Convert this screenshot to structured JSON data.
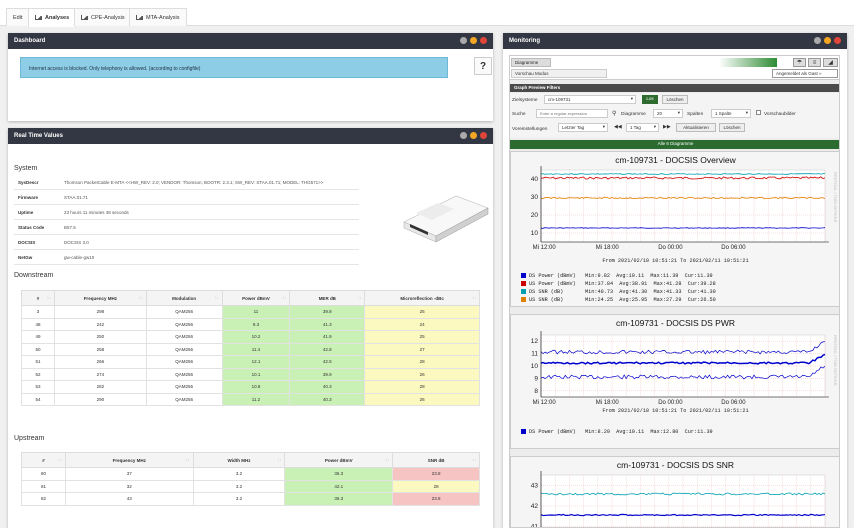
{
  "tabs": [
    {
      "label": "Edit"
    },
    {
      "label": "Analyses"
    },
    {
      "label": "CPE-Analysis"
    },
    {
      "label": "MTA-Analysis"
    }
  ],
  "dashboard": {
    "title": "Dashboard",
    "alert": "Internet access is blocked. Only telephony is allowed. (according to configfile)",
    "help": "?"
  },
  "realtime": {
    "title": "Real Time Values",
    "system_heading": "System",
    "system": [
      {
        "k": "SysDescr",
        "v": "Thomson PacketCable E-MTA <<HW_REV: 2.0; VENDOR: Thomson; BOOTR: 2.3.1; SW_REV: STAA.01.71; MODEL: THG571>>"
      },
      {
        "k": "Firmware",
        "v": "STAA.01.71"
      },
      {
        "k": "Uptime",
        "v": "23 hours 11 minutes 48 seconds"
      },
      {
        "k": "Status Code",
        "v": "B57.5"
      },
      {
        "k": "DOCSIS",
        "v": "DOCSIS 3.0"
      },
      {
        "k": "NetGw",
        "v": "gw-cable-gw10"
      }
    ],
    "downstream_heading": "Downstream",
    "ds_headers": [
      "#",
      "Frequency MHz",
      "Modulation",
      "Power dBmV",
      "MER dB",
      "Microreflection -dBc"
    ],
    "ds_rows": [
      [
        "3",
        "298",
        "QAM256",
        "11",
        "39.8",
        "25"
      ],
      [
        "48",
        "242",
        "QAM256",
        "9.3",
        "41.3",
        "24"
      ],
      [
        "49",
        "250",
        "QAM256",
        "10.2",
        "41.9",
        "25"
      ],
      [
        "50",
        "258",
        "QAM256",
        "11.4",
        "42.8",
        "27"
      ],
      [
        "51",
        "266",
        "QAM256",
        "12.1",
        "42.5",
        "28"
      ],
      [
        "52",
        "274",
        "QAM256",
        "10.1",
        "39.9",
        "26"
      ],
      [
        "53",
        "282",
        "QAM256",
        "10.8",
        "40.3",
        "28"
      ],
      [
        "54",
        "290",
        "QAM256",
        "11.2",
        "40.3",
        "26"
      ]
    ],
    "upstream_heading": "Upstream",
    "us_headers": [
      "#",
      "Frequency MHz",
      "Width MHz",
      "Power dBmV",
      "SNR dB"
    ],
    "us_rows": [
      [
        "80",
        "37",
        "3.2",
        "36.3",
        "23.8"
      ],
      [
        "81",
        "32",
        "3.2",
        "42.1",
        "28"
      ],
      [
        "82",
        "43",
        "3.2",
        "36.3",
        "23.8"
      ]
    ]
  },
  "monitoring": {
    "title": "Monitoring",
    "tab_label": "Diagramme",
    "sub_tab": "Vorschau Modus",
    "logged_in": "Angemeldet als Gast »",
    "filter_title": "Graph Preview Filters",
    "filter": {
      "ziel_label": "Zielsysteme",
      "ziel_value": "cm-109731",
      "los": "Los",
      "loeschen": "Löschen",
      "suche_label": "Suche",
      "suche_placeholder": "Enter a regular expression",
      "diagramme_label": "Diagramme",
      "diagramme_value": "20",
      "spalten_label": "Spalten",
      "spalten_value": "1 Spalte",
      "vorschau": "Vorschaubilder",
      "vor_label": "Voreinstellungen",
      "vor_value": "Letzter Tag",
      "tag_value": "1 Tag",
      "aktual": "Aktualisieren",
      "loeschen2": "Löschen"
    },
    "all_label": "Alle 6 Diagramme",
    "graphs": [
      {
        "title": "cm-109731 - DOCSIS  Overview",
        "from": "From 2021/02/10 10:51:21 To 2021/02/11 10:51:21",
        "legend": [
          "DS Power (dBmV)   Min:9.82  Avg:10.11  Max:11.39  Cur:11.39",
          "US Power (dBmV)   Min:37.84  Avg:38.91  Max:41.28  Cur:39.28",
          "DS SNR (dB)       Min:40.73  Avg:41.30  Max:41.33  Cur:41.30",
          "US SNR (dB)       Min:24.25  Avg:25.95  Max:27.29  Cur:26.50"
        ],
        "colors": [
          "#0000cc",
          "#cc0000",
          "#00a0b0",
          "#e08000"
        ],
        "yticks": [
          "40",
          "30",
          "20",
          "10"
        ],
        "xticks": [
          "Mi 12:00",
          "Mi 18:00",
          "Do 00:00",
          "Do 06:00"
        ],
        "gen": "Generated by CactiEZ"
      },
      {
        "title": "cm-109731 - DOCSIS DS PWR",
        "from": "From 2021/02/10 10:51:21 To 2021/02/11 10:51:21",
        "legend": [
          "DS Power (dBmV)   Min:8.20  Avg:10.11  Max:12.80  Cur:11.39"
        ],
        "colors": [
          "#0000cc"
        ],
        "yticks": [
          "12",
          "11",
          "10",
          "9",
          "8"
        ],
        "xticks": [
          "Mi 12:00",
          "Mi 18:00",
          "Do 00:00",
          "Do 06:00"
        ],
        "gen": "Generated by CactiEZ"
      },
      {
        "title": "cm-109731 - DOCSIS DS SNR",
        "yticks": [
          "43",
          "42",
          "41"
        ]
      }
    ],
    "rrd_label": "RRDTOOL / TOBI OETIKER"
  }
}
